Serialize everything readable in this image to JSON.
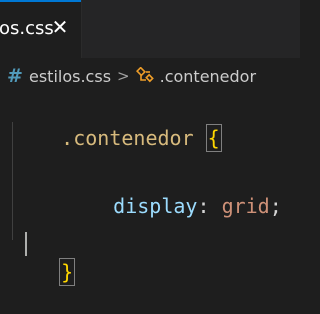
{
  "tab": {
    "label": "los.css",
    "close_glyph": "✕"
  },
  "breadcrumbs": {
    "file_icon": "#",
    "file": "estilos.css",
    "separator": ">",
    "symbol_icon": "class-symbol-icon",
    "symbol": ".contenedor"
  },
  "code": {
    "selector": ".contenedor",
    "space": " ",
    "open_brace": "{",
    "property": "display",
    "colon": ":",
    "value": "grid",
    "semicolon": ";",
    "close_brace": "}"
  },
  "colors": {
    "accent": "#0078d4",
    "selector": "#d7ba7d",
    "brace": "#ffd700",
    "property": "#9cdcfe",
    "value": "#ce9178",
    "css_icon": "#519aba"
  }
}
